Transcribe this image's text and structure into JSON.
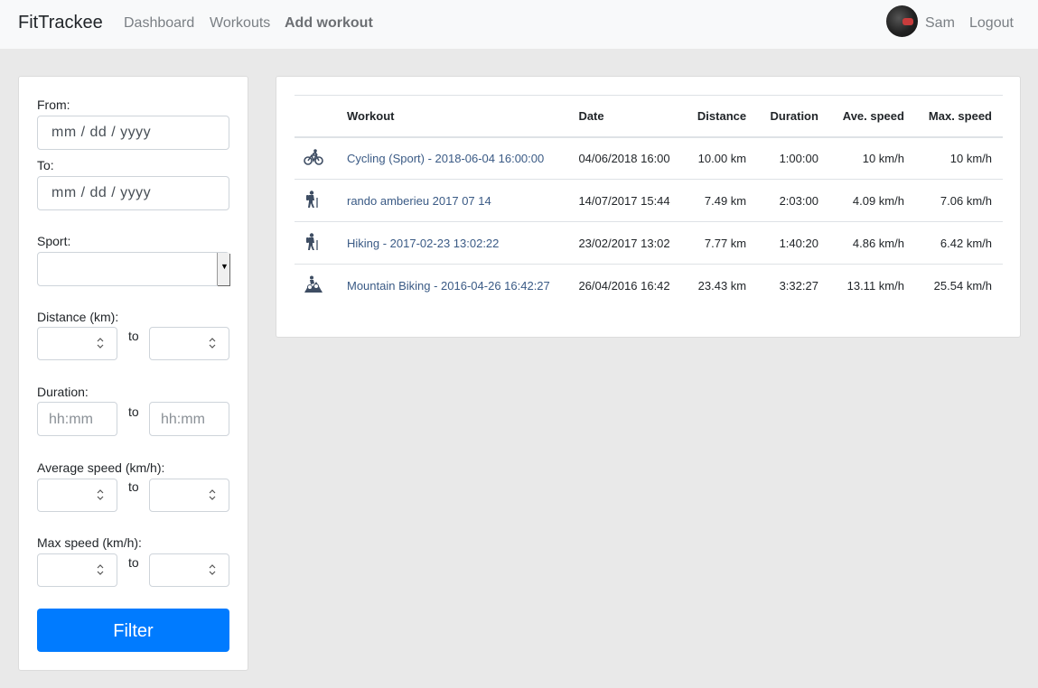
{
  "navbar": {
    "brand": "FitTrackee",
    "links": [
      "Dashboard",
      "Workouts",
      "Add workout"
    ],
    "user": "Sam",
    "logout": "Logout"
  },
  "filters": {
    "from_label": "From:",
    "from_value": "mm / dd / yyyy",
    "to_label": "To:",
    "to_value": "mm / dd / yyyy",
    "sport_label": "Sport:",
    "sport_value": "",
    "distance_label": "Distance (km):",
    "duration_label": "Duration:",
    "duration_placeholder": "hh:mm",
    "ave_speed_label": "Average speed (km/h):",
    "max_speed_label": "Max speed (km/h):",
    "to_text": "to",
    "filter_button": "Filter"
  },
  "table": {
    "headers": [
      "Workout",
      "Date",
      "Distance",
      "Duration",
      "Ave. speed",
      "Max. speed"
    ],
    "rows": [
      {
        "icon": "cycling-icon",
        "workout": "Cycling (Sport) - 2018-06-04 16:00:00",
        "date": "04/06/2018 16:00",
        "distance": "10.00 km",
        "duration": "1:00:00",
        "ave_speed": "10 km/h",
        "max_speed": "10 km/h"
      },
      {
        "icon": "hiking-icon",
        "workout": "rando amberieu 2017 07 14",
        "date": "14/07/2017 15:44",
        "distance": "7.49 km",
        "duration": "2:03:00",
        "ave_speed": "4.09 km/h",
        "max_speed": "7.06 km/h"
      },
      {
        "icon": "hiking-icon",
        "workout": "Hiking - 2017-02-23 13:02:22",
        "date": "23/02/2017 13:02",
        "distance": "7.77 km",
        "duration": "1:40:20",
        "ave_speed": "4.86 km/h",
        "max_speed": "6.42 km/h"
      },
      {
        "icon": "mountain-biking-icon",
        "workout": "Mountain Biking - 2016-04-26 16:42:27",
        "date": "26/04/2016 16:42",
        "distance": "23.43 km",
        "duration": "3:32:27",
        "ave_speed": "13.11 km/h",
        "max_speed": "25.54 km/h"
      }
    ]
  },
  "colors": {
    "primary": "#007bff",
    "link": "#3a5a85",
    "navbar_bg": "#f8f9fa",
    "page_bg": "#e9e9e9"
  }
}
